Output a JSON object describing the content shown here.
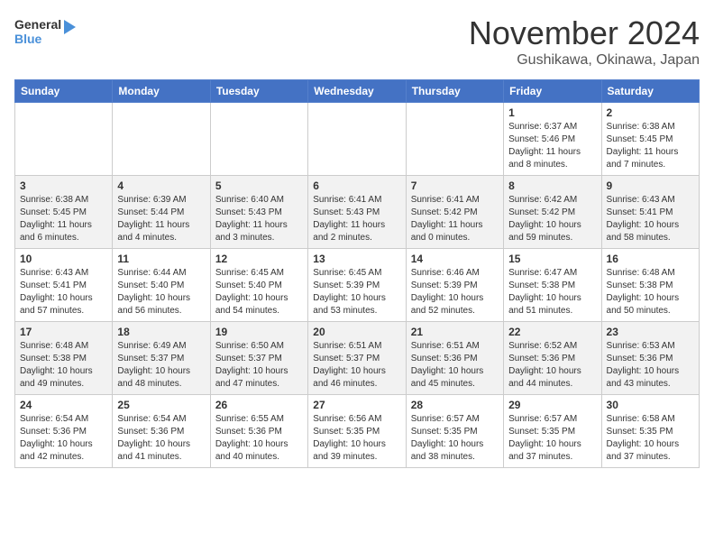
{
  "header": {
    "logo_general": "General",
    "logo_blue": "Blue",
    "month": "November 2024",
    "location": "Gushikawa, Okinawa, Japan"
  },
  "weekdays": [
    "Sunday",
    "Monday",
    "Tuesday",
    "Wednesday",
    "Thursday",
    "Friday",
    "Saturday"
  ],
  "weeks": [
    [
      {
        "day": "",
        "sunrise": "",
        "sunset": "",
        "daylight": "",
        "empty": true
      },
      {
        "day": "",
        "sunrise": "",
        "sunset": "",
        "daylight": "",
        "empty": true
      },
      {
        "day": "",
        "sunrise": "",
        "sunset": "",
        "daylight": "",
        "empty": true
      },
      {
        "day": "",
        "sunrise": "",
        "sunset": "",
        "daylight": "",
        "empty": true
      },
      {
        "day": "",
        "sunrise": "",
        "sunset": "",
        "daylight": "",
        "empty": true
      },
      {
        "day": "1",
        "sunrise": "Sunrise: 6:37 AM",
        "sunset": "Sunset: 5:46 PM",
        "daylight": "Daylight: 11 hours and 8 minutes."
      },
      {
        "day": "2",
        "sunrise": "Sunrise: 6:38 AM",
        "sunset": "Sunset: 5:45 PM",
        "daylight": "Daylight: 11 hours and 7 minutes."
      }
    ],
    [
      {
        "day": "3",
        "sunrise": "Sunrise: 6:38 AM",
        "sunset": "Sunset: 5:45 PM",
        "daylight": "Daylight: 11 hours and 6 minutes."
      },
      {
        "day": "4",
        "sunrise": "Sunrise: 6:39 AM",
        "sunset": "Sunset: 5:44 PM",
        "daylight": "Daylight: 11 hours and 4 minutes."
      },
      {
        "day": "5",
        "sunrise": "Sunrise: 6:40 AM",
        "sunset": "Sunset: 5:43 PM",
        "daylight": "Daylight: 11 hours and 3 minutes."
      },
      {
        "day": "6",
        "sunrise": "Sunrise: 6:41 AM",
        "sunset": "Sunset: 5:43 PM",
        "daylight": "Daylight: 11 hours and 2 minutes."
      },
      {
        "day": "7",
        "sunrise": "Sunrise: 6:41 AM",
        "sunset": "Sunset: 5:42 PM",
        "daylight": "Daylight: 11 hours and 0 minutes."
      },
      {
        "day": "8",
        "sunrise": "Sunrise: 6:42 AM",
        "sunset": "Sunset: 5:42 PM",
        "daylight": "Daylight: 10 hours and 59 minutes."
      },
      {
        "day": "9",
        "sunrise": "Sunrise: 6:43 AM",
        "sunset": "Sunset: 5:41 PM",
        "daylight": "Daylight: 10 hours and 58 minutes."
      }
    ],
    [
      {
        "day": "10",
        "sunrise": "Sunrise: 6:43 AM",
        "sunset": "Sunset: 5:41 PM",
        "daylight": "Daylight: 10 hours and 57 minutes."
      },
      {
        "day": "11",
        "sunrise": "Sunrise: 6:44 AM",
        "sunset": "Sunset: 5:40 PM",
        "daylight": "Daylight: 10 hours and 56 minutes."
      },
      {
        "day": "12",
        "sunrise": "Sunrise: 6:45 AM",
        "sunset": "Sunset: 5:40 PM",
        "daylight": "Daylight: 10 hours and 54 minutes."
      },
      {
        "day": "13",
        "sunrise": "Sunrise: 6:45 AM",
        "sunset": "Sunset: 5:39 PM",
        "daylight": "Daylight: 10 hours and 53 minutes."
      },
      {
        "day": "14",
        "sunrise": "Sunrise: 6:46 AM",
        "sunset": "Sunset: 5:39 PM",
        "daylight": "Daylight: 10 hours and 52 minutes."
      },
      {
        "day": "15",
        "sunrise": "Sunrise: 6:47 AM",
        "sunset": "Sunset: 5:38 PM",
        "daylight": "Daylight: 10 hours and 51 minutes."
      },
      {
        "day": "16",
        "sunrise": "Sunrise: 6:48 AM",
        "sunset": "Sunset: 5:38 PM",
        "daylight": "Daylight: 10 hours and 50 minutes."
      }
    ],
    [
      {
        "day": "17",
        "sunrise": "Sunrise: 6:48 AM",
        "sunset": "Sunset: 5:38 PM",
        "daylight": "Daylight: 10 hours and 49 minutes."
      },
      {
        "day": "18",
        "sunrise": "Sunrise: 6:49 AM",
        "sunset": "Sunset: 5:37 PM",
        "daylight": "Daylight: 10 hours and 48 minutes."
      },
      {
        "day": "19",
        "sunrise": "Sunrise: 6:50 AM",
        "sunset": "Sunset: 5:37 PM",
        "daylight": "Daylight: 10 hours and 47 minutes."
      },
      {
        "day": "20",
        "sunrise": "Sunrise: 6:51 AM",
        "sunset": "Sunset: 5:37 PM",
        "daylight": "Daylight: 10 hours and 46 minutes."
      },
      {
        "day": "21",
        "sunrise": "Sunrise: 6:51 AM",
        "sunset": "Sunset: 5:36 PM",
        "daylight": "Daylight: 10 hours and 45 minutes."
      },
      {
        "day": "22",
        "sunrise": "Sunrise: 6:52 AM",
        "sunset": "Sunset: 5:36 PM",
        "daylight": "Daylight: 10 hours and 44 minutes."
      },
      {
        "day": "23",
        "sunrise": "Sunrise: 6:53 AM",
        "sunset": "Sunset: 5:36 PM",
        "daylight": "Daylight: 10 hours and 43 minutes."
      }
    ],
    [
      {
        "day": "24",
        "sunrise": "Sunrise: 6:54 AM",
        "sunset": "Sunset: 5:36 PM",
        "daylight": "Daylight: 10 hours and 42 minutes."
      },
      {
        "day": "25",
        "sunrise": "Sunrise: 6:54 AM",
        "sunset": "Sunset: 5:36 PM",
        "daylight": "Daylight: 10 hours and 41 minutes."
      },
      {
        "day": "26",
        "sunrise": "Sunrise: 6:55 AM",
        "sunset": "Sunset: 5:36 PM",
        "daylight": "Daylight: 10 hours and 40 minutes."
      },
      {
        "day": "27",
        "sunrise": "Sunrise: 6:56 AM",
        "sunset": "Sunset: 5:35 PM",
        "daylight": "Daylight: 10 hours and 39 minutes."
      },
      {
        "day": "28",
        "sunrise": "Sunrise: 6:57 AM",
        "sunset": "Sunset: 5:35 PM",
        "daylight": "Daylight: 10 hours and 38 minutes."
      },
      {
        "day": "29",
        "sunrise": "Sunrise: 6:57 AM",
        "sunset": "Sunset: 5:35 PM",
        "daylight": "Daylight: 10 hours and 37 minutes."
      },
      {
        "day": "30",
        "sunrise": "Sunrise: 6:58 AM",
        "sunset": "Sunset: 5:35 PM",
        "daylight": "Daylight: 10 hours and 37 minutes."
      }
    ]
  ]
}
